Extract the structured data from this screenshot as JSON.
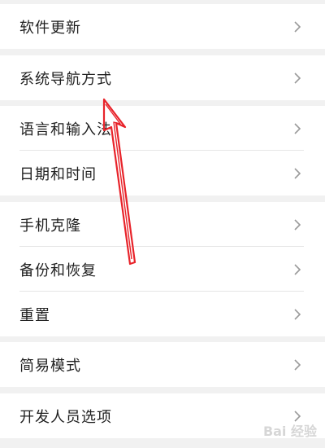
{
  "settings": {
    "groups": [
      {
        "items": [
          {
            "label": "软件更新",
            "icon": "chevron-right-icon"
          }
        ]
      },
      {
        "items": [
          {
            "label": "系统导航方式",
            "icon": "chevron-right-icon"
          }
        ]
      },
      {
        "items": [
          {
            "label": "语言和输入法",
            "icon": "chevron-right-icon"
          },
          {
            "label": "日期和时间",
            "icon": "chevron-right-icon"
          }
        ]
      },
      {
        "items": [
          {
            "label": "手机克隆",
            "icon": "chevron-right-icon"
          },
          {
            "label": "备份和恢复",
            "icon": "chevron-right-icon"
          },
          {
            "label": "重置",
            "icon": "chevron-right-icon"
          }
        ]
      },
      {
        "items": [
          {
            "label": "简易模式",
            "icon": "chevron-right-icon"
          }
        ]
      },
      {
        "items": [
          {
            "label": "开发人员选项",
            "icon": "chevron-right-icon"
          }
        ]
      }
    ]
  },
  "annotation": {
    "color": "#e8232a"
  },
  "watermark": {
    "text": "Bai 经验"
  }
}
